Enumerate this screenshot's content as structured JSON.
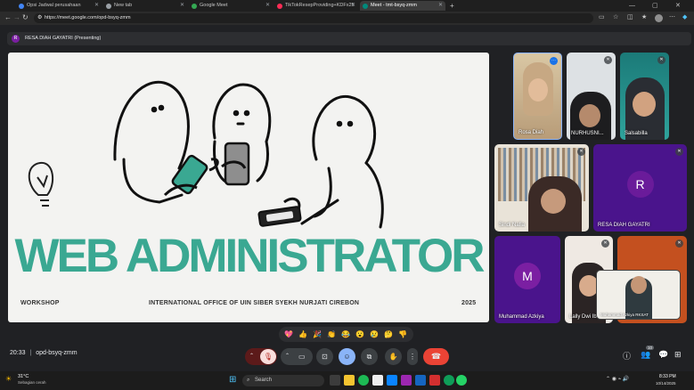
{
  "browser": {
    "tabs": [
      {
        "label": "Opsi Jadwal perusahaan"
      },
      {
        "label": "New tab"
      },
      {
        "label": "Google Meet"
      },
      {
        "label": "TikTokResepProviding+KDFx25"
      },
      {
        "label": "Meet - tmt-bsyq-zmm"
      }
    ],
    "url": "https://meet.google.com/opd-bsyq-zmm"
  },
  "presenting": {
    "avatar_letter": "R",
    "label": "RESA DIAH GAYATRI (Presenting)"
  },
  "slide": {
    "title": "WEB ADMINISTRATOR",
    "left_footer": "WORKSHOP",
    "center_footer": "INTERNATIONAL OFFICE OF UIN SIBER SYEKH NURJATI CIREBON",
    "right_footer": "2025"
  },
  "participants": [
    {
      "name": "Rosa Diah"
    },
    {
      "name": "NURHUSNI..."
    },
    {
      "name": "Salsabilla"
    },
    {
      "name": "Sindi Nafia"
    },
    {
      "name": "RESA DIAH GAYATRI",
      "avatar_letter": "R"
    },
    {
      "name": "Muhammad Azkiya",
      "avatar_letter": "M"
    },
    {
      "name": "Lally Dwi Ibr..."
    },
    {
      "name": "Muhammad Azkiya RKSAT"
    }
  ],
  "reactions": [
    "💖",
    "👍",
    "🎉",
    "👏",
    "😂",
    "😮",
    "😢",
    "🤔",
    "👎"
  ],
  "controls": {
    "time": "20:33",
    "separator": "|",
    "meeting_code": "opd-bsyq-zmm",
    "people_count": "10"
  },
  "taskbar": {
    "weather_temp": "31°C",
    "weather_desc": "Sebagian cerah",
    "search_placeholder": "Search",
    "clock_time": "8:33 PM",
    "clock_date": "10/14/2025"
  },
  "colors": {
    "accent": "#3aa892",
    "purple_tile": "#4a148c",
    "hangup": "#ea4335",
    "active_control": "#8ab4f8"
  }
}
